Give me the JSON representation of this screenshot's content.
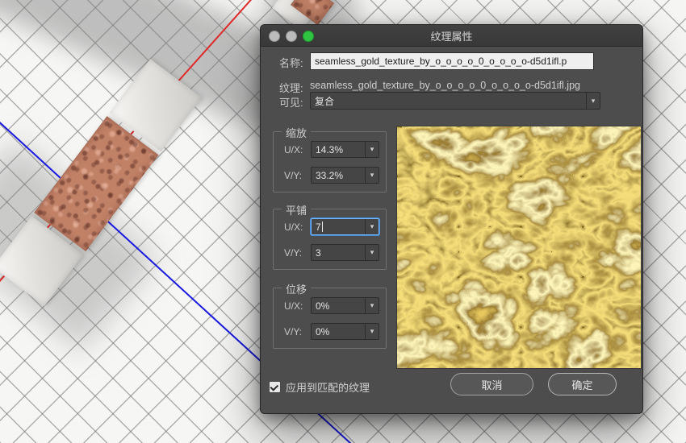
{
  "viewport": {
    "axis_colors": {
      "x_axis": "#e02a2a",
      "z_axis": "#1a1ae0"
    }
  },
  "dialog": {
    "title": "纹理属性",
    "traffic_lights": {
      "close": "#bcbcbc",
      "minimize": "#bcbcbc",
      "zoom": "#2fc441"
    },
    "name_label": "名称:",
    "name_value": "seamless_gold_texture_by_o_o_o_o_0_o_o_o_o-d5d1ifl.p",
    "texture_label": "纹理:",
    "texture_value": "seamless_gold_texture_by_o_o_o_o_0_o_o_o_o-d5d1ifl.jpg",
    "visible_label": "可见:",
    "visible_value": "复合",
    "icons": {
      "chevron_down": "▾"
    },
    "groups": [
      {
        "title": "缩放",
        "rows": [
          {
            "label": "U/X:",
            "value": "14.3%"
          },
          {
            "label": "V/Y:",
            "value": "33.2%"
          }
        ]
      },
      {
        "title": "平铺",
        "rows": [
          {
            "label": "U/X:",
            "value": "7"
          },
          {
            "label": "V/Y:",
            "value": "3"
          }
        ]
      },
      {
        "title": "位移",
        "rows": [
          {
            "label": "U/X:",
            "value": "0%"
          },
          {
            "label": "V/Y:",
            "value": "0%"
          }
        ]
      }
    ],
    "apply_checkbox_label": "应用到匹配的纹理",
    "cancel_label": "取消",
    "ok_label": "确定",
    "focus_color": "#4d9fff"
  }
}
